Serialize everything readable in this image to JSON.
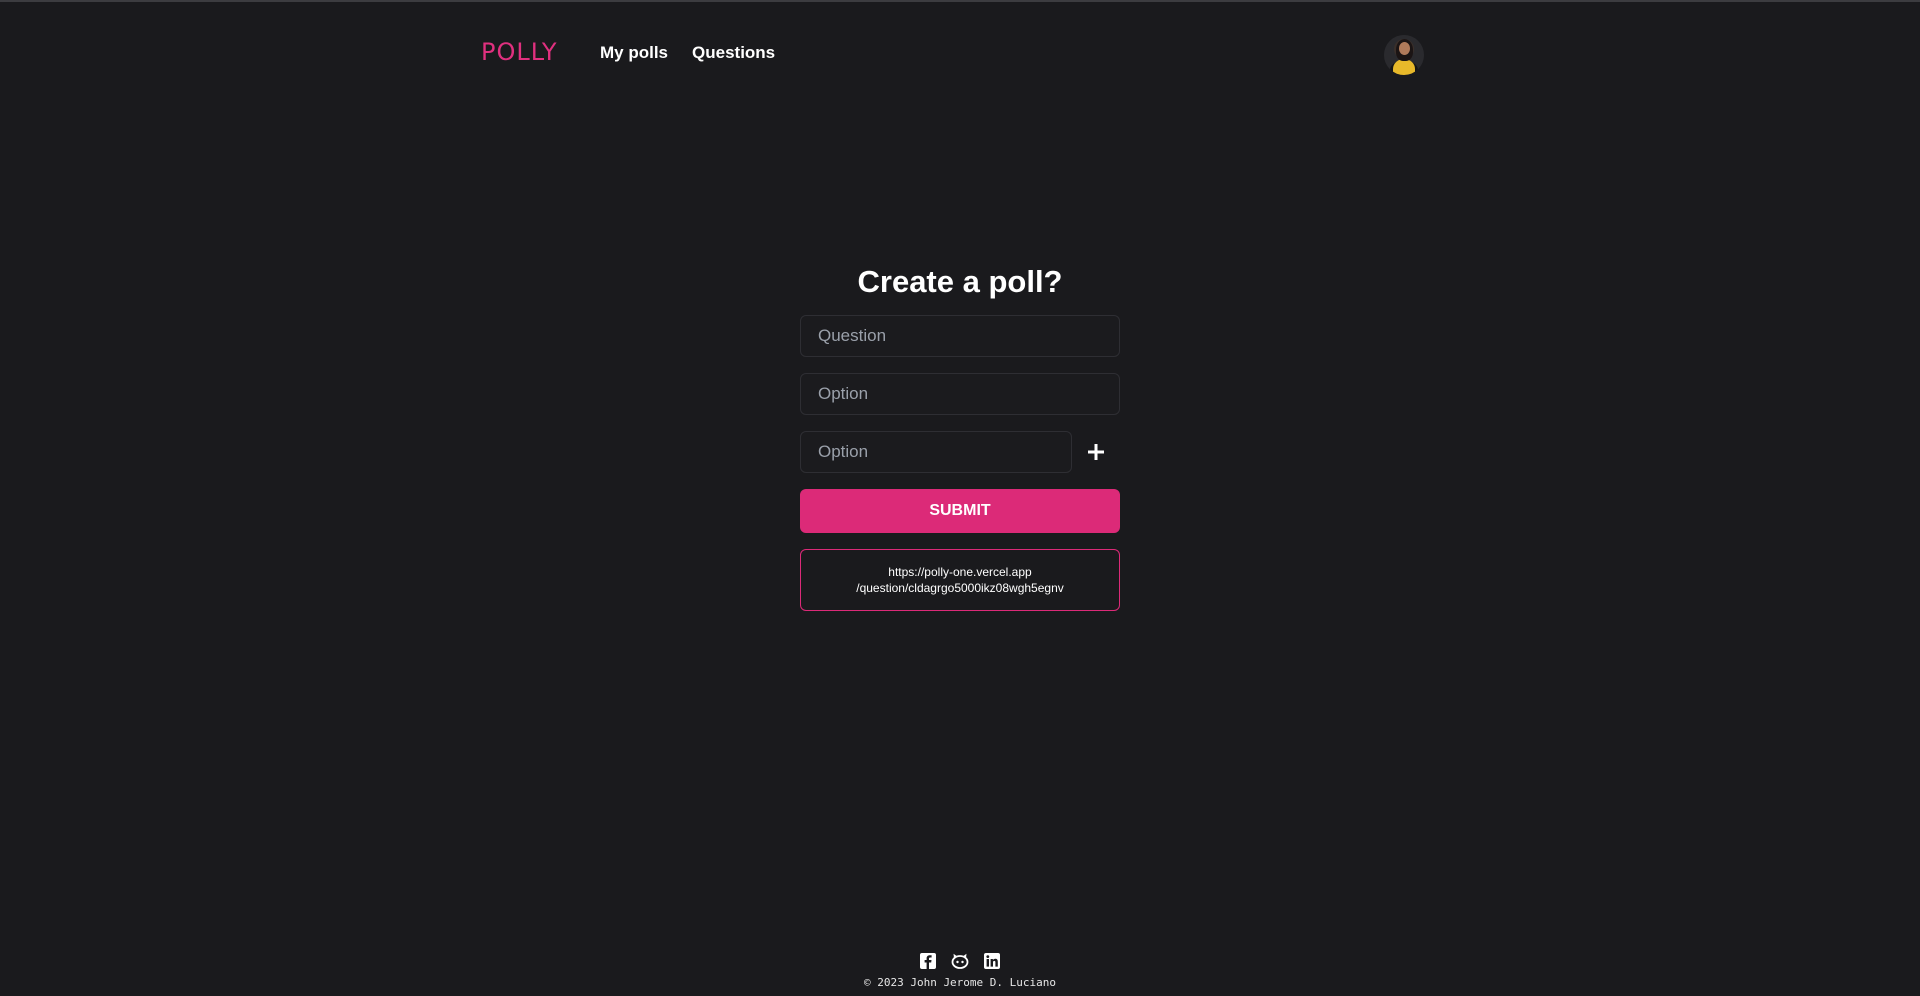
{
  "header": {
    "logo": "POLLY",
    "nav": {
      "my_polls": "My polls",
      "questions": "Questions"
    },
    "avatar_icon": "user-avatar"
  },
  "form": {
    "title": "Create a poll?",
    "question_placeholder": "Question",
    "option_placeholder_1": "Option",
    "option_placeholder_2": "Option",
    "add_icon": "plus-icon",
    "submit_label": "SUBMIT",
    "link_line_1": "https://polly-one.vercel.app",
    "link_line_2": "/question/cldagrgo5000ikz08wgh5egnv"
  },
  "footer": {
    "icons": [
      "facebook-icon",
      "github-icon",
      "linkedin-icon"
    ],
    "copyright": "© 2023 John Jerome D. Luciano"
  },
  "colors": {
    "background": "#1a1a1d",
    "accent": "#dc2a78",
    "logo": "#e0307f"
  }
}
